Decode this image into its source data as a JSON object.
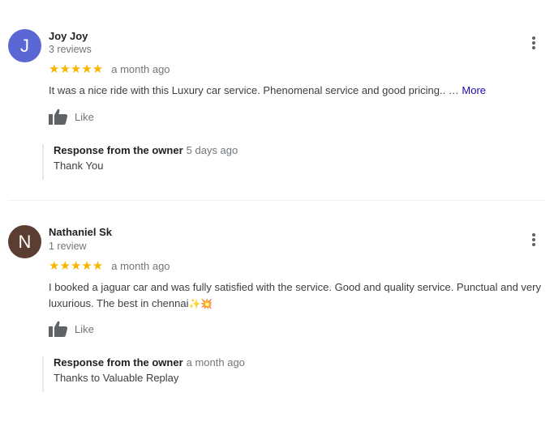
{
  "reviews": [
    {
      "avatar_letter": "J",
      "avatar_color": "#5b67d4",
      "name": "Joy Joy",
      "review_count": "3 reviews",
      "stars": "★★★★★",
      "rating": 5,
      "time": "a month ago",
      "text": "It was a nice ride with this Luxury car service. Phenomenal service and good pricing.. … ",
      "more_label": "More",
      "like_label": "Like",
      "owner_response_title": "Response from the owner",
      "owner_response_time": "5 days ago",
      "owner_response_text": "Thank You"
    },
    {
      "avatar_letter": "N",
      "avatar_color": "#5c3d32",
      "name": "Nathaniel Sk",
      "review_count": "1 review",
      "stars": "★★★★★",
      "rating": 5,
      "time": "a month ago",
      "text": "I booked a jaguar car and was fully satisfied with the service. Good and quality service. Punctual and very luxurious. The best in chennai",
      "emojis": "✨💥",
      "like_label": "Like",
      "owner_response_title": "Response from the owner",
      "owner_response_time": "a month ago",
      "owner_response_text": "Thanks to Valuable Replay"
    }
  ],
  "colors": {
    "star": "#f7b500",
    "more_link": "#1a0dab",
    "muted": "#70757a"
  },
  "icons": {
    "like": "thumbs-up-icon",
    "menu": "more-vert-icon"
  }
}
